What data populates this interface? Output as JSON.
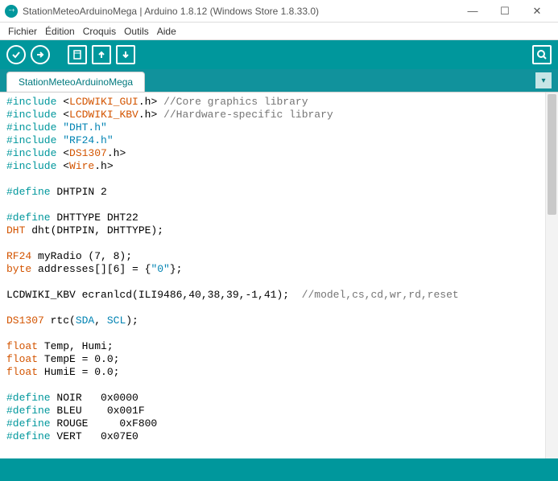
{
  "window": {
    "title": "StationMeteoArduinoMega | Arduino 1.8.12 (Windows Store 1.8.33.0)",
    "minimize": "—",
    "maximize": "☐",
    "close": "✕"
  },
  "menu": {
    "file": "Fichier",
    "edit": "Édition",
    "sketch": "Croquis",
    "tools": "Outils",
    "help": "Aide"
  },
  "toolbar": {
    "verify": "✓",
    "upload": "➔",
    "new": "▭",
    "open": "↑",
    "save": "↓",
    "serial": "🔍"
  },
  "tabs": {
    "main": "StationMeteoArduinoMega",
    "dropdown": "▾"
  },
  "code": {
    "l1_inc": "#include ",
    "l1_lt": "<",
    "l1_lib": "LCDWIKI_GUI",
    "l1_ext": ".h>",
    "l1_com": " //Core graphics library",
    "l2_inc": "#include ",
    "l2_lt": "<",
    "l2_lib": "LCDWIKI_KBV",
    "l2_ext": ".h>",
    "l2_com": " //Hardware-specific library",
    "l3_inc": "#include ",
    "l3_str": "\"DHT.h\"",
    "l4_inc": "#include ",
    "l4_str": "\"RF24.h\"",
    "l5_inc": "#include ",
    "l5_lt": "<",
    "l5_lib": "DS1307",
    "l5_ext": ".h>",
    "l6_inc": "#include ",
    "l6_lt": "<",
    "l6_lib": "Wire",
    "l6_ext": ".h>",
    "l8_def": "#define",
    "l8_rest": " DHTPIN 2",
    "l10_def": "#define",
    "l10_rest": " DHTTYPE DHT22",
    "l11_ty": "DHT",
    "l11_rest": " dht(DHTPIN, DHTTYPE);",
    "l13_ty": "RF24",
    "l13_rest": " myRadio (7, 8);",
    "l14_ty": "byte",
    "l14_rest": " addresses[][6] = {",
    "l14_str": "\"0\"",
    "l14_end": "};",
    "l16_rest": "LCDWIKI_KBV ecranlcd(ILI9486,40,38,39,-1,41); ",
    "l16_com": " //model,cs,cd,wr,rd,reset",
    "l18_ty": "DS1307",
    "l18_a": " rtc(",
    "l18_sda": "SDA",
    "l18_comma": ", ",
    "l18_scl": "SCL",
    "l18_end": ");",
    "l20_ty": "float",
    "l20_rest": " Temp, Humi;",
    "l21_ty": "float",
    "l21_rest": " TempE = 0.0;",
    "l22_ty": "float",
    "l22_rest": " HumiE = 0.0;",
    "l24_def": "#define",
    "l24_rest": " NOIR   0x0000",
    "l25_def": "#define",
    "l25_rest": " BLEU    0x001F",
    "l26_def": "#define",
    "l26_rest": " ROUGE     0xF800",
    "l27_def": "#define",
    "l27_rest": " VERT   0x07E0"
  }
}
